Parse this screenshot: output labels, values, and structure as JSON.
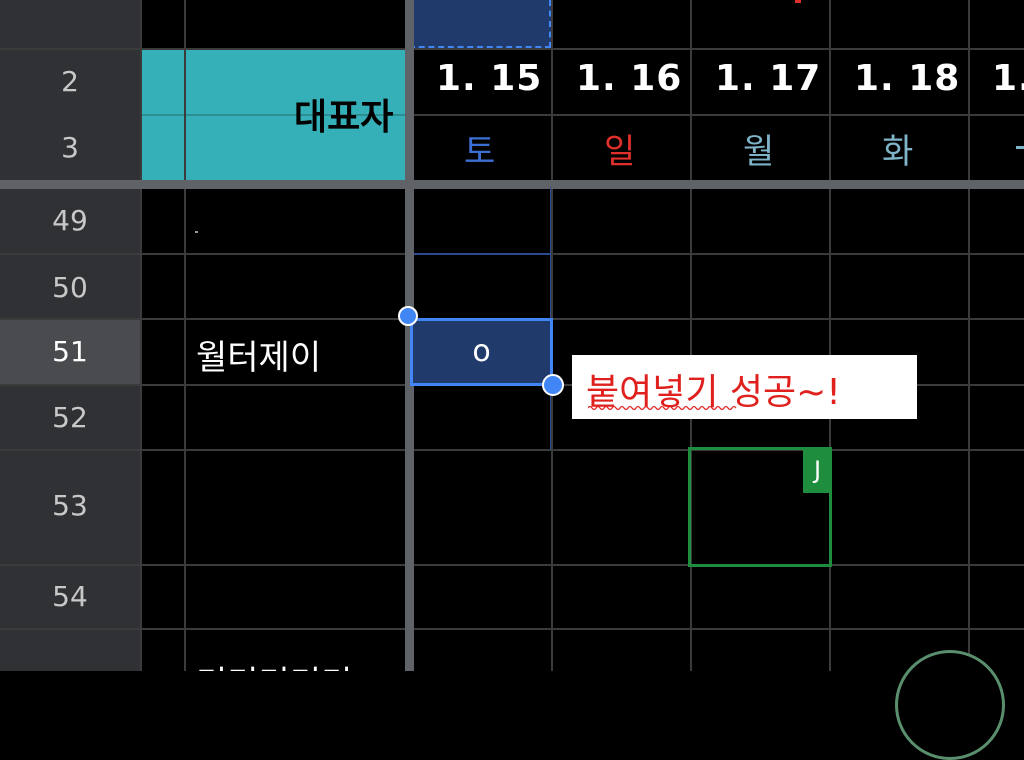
{
  "rows": [
    {
      "num": "2",
      "active": false
    },
    {
      "num": "3",
      "active": false
    },
    {
      "num": "49",
      "active": false
    },
    {
      "num": "50",
      "active": false
    },
    {
      "num": "51",
      "active": true
    },
    {
      "num": "52",
      "active": false
    },
    {
      "num": "53",
      "active": false
    },
    {
      "num": "54",
      "active": false
    }
  ],
  "header": {
    "label": "대표자",
    "dates": [
      "1. 15",
      "1. 16",
      "1. 17",
      "1. 18",
      "1."
    ],
    "weekdays": [
      "토",
      "일",
      "월",
      "화"
    ]
  },
  "names": {
    "row51": "월터제이",
    "row55_partial": "미미미미미"
  },
  "cells": {
    "selected_value": "o"
  },
  "tooltip": {
    "text": "붙여넣기 성공~!"
  },
  "collaborator": {
    "initial": "J",
    "color": "#1e8e3e"
  },
  "colors": {
    "header_fill": "#35b0b8",
    "selection": "#1f3a6b",
    "selection_border": "#4285f4",
    "saturday": "#3b6fd4",
    "sunday": "#e0302c",
    "weekday": "#7fb3c8"
  }
}
